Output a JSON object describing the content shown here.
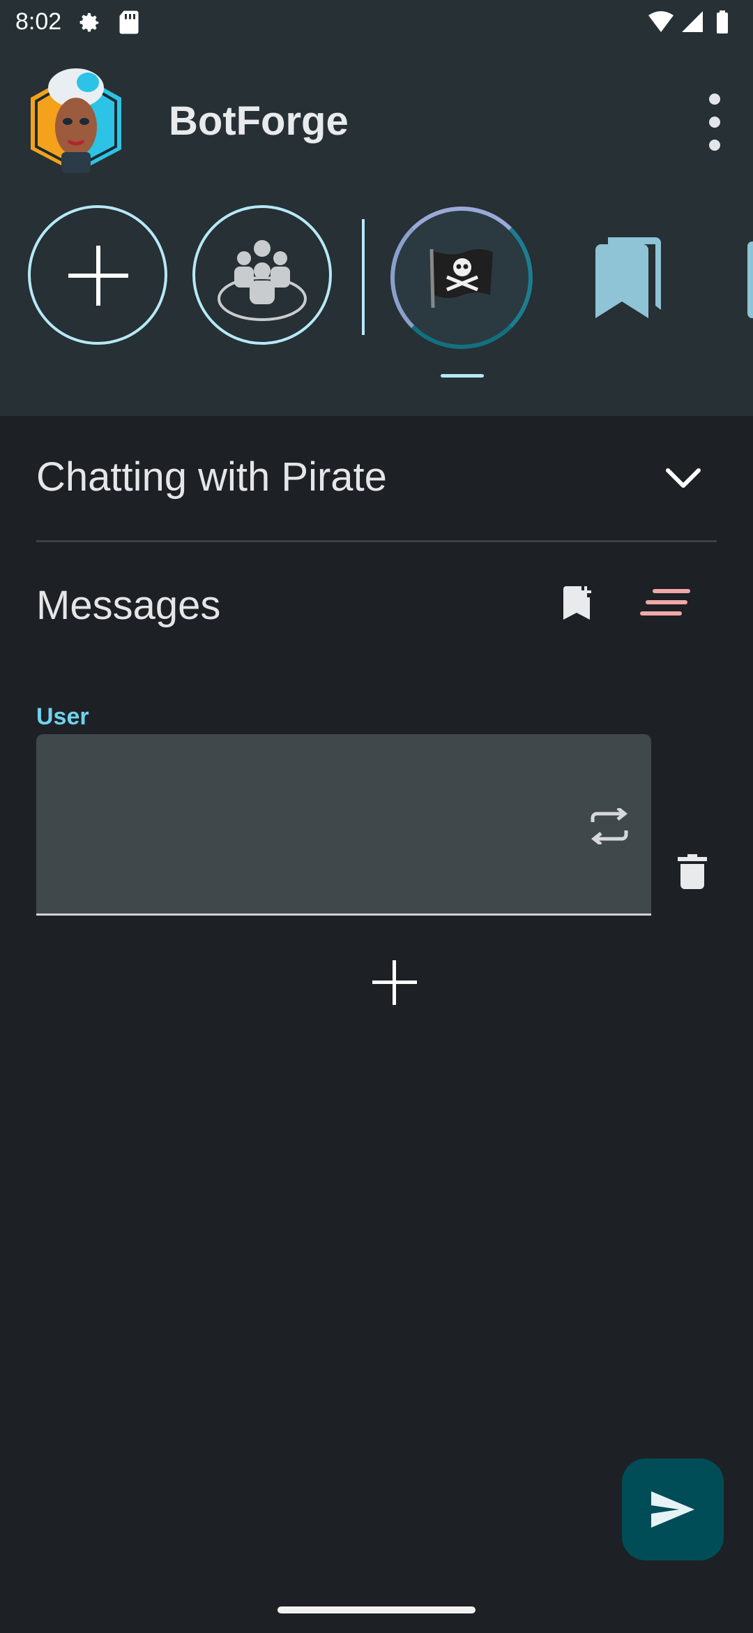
{
  "status_bar": {
    "time": "8:02",
    "icons": [
      "gear-icon",
      "sd-card-icon",
      "wifi-icon",
      "signal-icon",
      "battery-icon"
    ]
  },
  "app_bar": {
    "title": "BotForge",
    "logo": "botforge-avatar-logo",
    "menu_icon": "more-vert-icon"
  },
  "bot_strip": {
    "items": [
      {
        "name": "add-bot",
        "icon": "plus-icon"
      },
      {
        "name": "group-chat",
        "icon": "group-icon"
      },
      {
        "name": "pirate",
        "icon": "pirate-flag-icon",
        "selected": true
      },
      {
        "name": "bookmarks",
        "icon": "bookmarks-icon"
      }
    ]
  },
  "chat": {
    "title": "Chatting with Pirate",
    "expand_icon": "chevron-down-icon"
  },
  "messages": {
    "label": "Messages",
    "bookmark_icon": "bookmark-add-icon",
    "clear_icon": "clear-all-icon",
    "items": [
      {
        "role": "User",
        "text": ""
      }
    ]
  },
  "colors": {
    "accent": "#6fd3ee",
    "outline": "#b7e9f7",
    "clear_accent": "#f2a8a8",
    "fab": "#014d57",
    "background": "#1d2125",
    "surface": "#263035"
  }
}
